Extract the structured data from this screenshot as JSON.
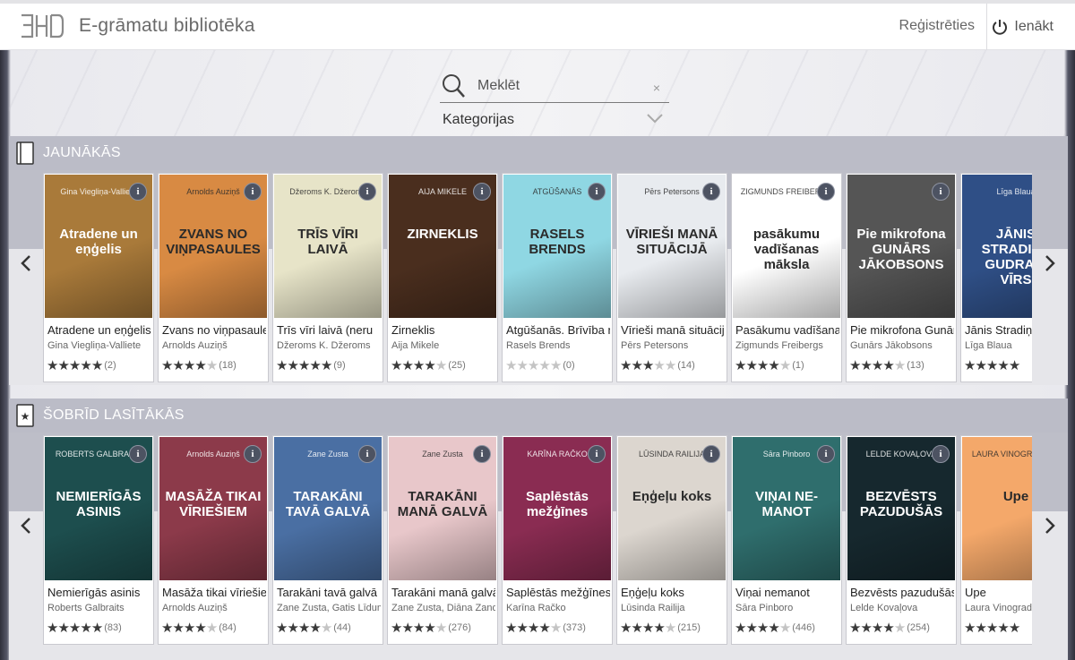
{
  "header": {
    "site_title": "E-grāmatu  bibliotēka",
    "register_label": "Reģistrēties",
    "login_label": "Ienākt"
  },
  "search": {
    "placeholder": "Meklēt",
    "clear_symbol": "×",
    "categories_label": "Kategorijas"
  },
  "sections": [
    {
      "title": "JAUNĀKĀS",
      "icon": "book-icon",
      "books": [
        {
          "title": "Atradene un eņģelis",
          "author": "Gina Viegliņa-Valliete",
          "stars": 5,
          "count": "(2)",
          "cover_text": "Atradene un eņģelis",
          "cover_sub": "Gina Viegliņa-Valliete",
          "color": "#a97a3a"
        },
        {
          "title": "Zvans no viņpasaules",
          "author": "Arnolds Auziņš",
          "stars": 4,
          "count": "(18)",
          "cover_text": "ZVANS NO VIŅPASAULES",
          "cover_sub": "Arnolds Auziņš",
          "color": "#d88a43"
        },
        {
          "title": "Trīs vīri laivā (neru",
          "author": "Džeroms K. Džeroms",
          "stars": 5,
          "count": "(9)",
          "cover_text": "TRĪS VĪRI LAIVĀ",
          "cover_sub": "Džeroms K. Džeroms",
          "color": "#e7e4c8"
        },
        {
          "title": "Zirneklis",
          "author": "Aija Mikele",
          "stars": 4.5,
          "count": "(25)",
          "cover_text": "ZIRNEKLIS",
          "cover_sub": "AIJA MIKELE",
          "color": "#4a2e1e"
        },
        {
          "title": "Atgūšanās. Brīvība no",
          "author": "Rasels Brends",
          "stars": 0,
          "count": "(0)",
          "cover_text": "RASELS BRENDS",
          "cover_sub": "ATGŪŠANĀS",
          "color": "#8fd7e3"
        },
        {
          "title": "Vīrieši manā situācijā",
          "author": "Pērs Petersons",
          "stars": 3.5,
          "count": "(14)",
          "cover_text": "VĪRIEŠI MANĀ SITUĀCIJĀ",
          "cover_sub": "Pērs Petersons",
          "color": "#e8ebef"
        },
        {
          "title": "Pasākumu vadīšanas",
          "author": "Zigmunds Freibergs",
          "stars": 4,
          "count": "(1)",
          "cover_text": "pasākumu vadīšanas māksla",
          "cover_sub": "ZIGMUNDS FREIBERGS",
          "color": "#ffffff"
        },
        {
          "title": "Pie mikrofona Gunārs",
          "author": "Gunārs Jākobsons",
          "stars": 4.5,
          "count": "(13)",
          "cover_text": "Pie mikrofona GUNĀRS JĀKOBSONS",
          "cover_sub": "",
          "color": "#555555"
        },
        {
          "title": "Jānis Stradiņš",
          "author": "Līga Blaua",
          "stars": 5,
          "count": "",
          "cover_text": "JĀNIS STRADIŅŠ GUDRAIS VĪRS",
          "cover_sub": "Līga Blaua",
          "color": "#2f4f86"
        }
      ]
    },
    {
      "title": "ŠOBRĪD LASĪTĀKĀS",
      "icon": "star-book-icon",
      "books": [
        {
          "title": "Nemierīgās asinis",
          "author": "Roberts Galbraits",
          "stars": 5,
          "count": "(83)",
          "cover_text": "NEMIERĪGĀS ASINIS",
          "cover_sub": "ROBERTS GALBRAITS",
          "color": "#1d4e4e"
        },
        {
          "title": "Masāža tikai vīriešiem",
          "author": "Arnolds Auziņš",
          "stars": 4,
          "count": "(84)",
          "cover_text": "MASĀŽA TIKAI VĪRIEŠIEM",
          "cover_sub": "Arnolds Auziņš",
          "color": "#8c3a4a"
        },
        {
          "title": "Tarakāni tavā galvā",
          "author": "Zane Zusta, Gatis Līduma",
          "stars": 4,
          "count": "(44)",
          "cover_text": "TARAKĀNI TAVĀ GALVĀ",
          "cover_sub": "Zane Zusta",
          "color": "#4a6fa3"
        },
        {
          "title": "Tarakāni manā galvā",
          "author": "Zane Zusta, Diāna Zande",
          "stars": 4,
          "count": "(276)",
          "cover_text": "TARAKĀNI MANĀ GALVĀ",
          "cover_sub": "Zane Zusta",
          "color": "#e8c7ca"
        },
        {
          "title": "Saplēstās mežģīnes",
          "author": "Karīna Račko",
          "stars": 4,
          "count": "(373)",
          "cover_text": "Saplēstās mežģīnes",
          "cover_sub": "KARĪNA RAČKO",
          "color": "#8a2c52"
        },
        {
          "title": "Eņģeļu koks",
          "author": "Lūsinda Railija",
          "stars": 4.5,
          "count": "(215)",
          "cover_text": "Eņģeļu koks",
          "cover_sub": "LŪSINDA RAILIJA",
          "color": "#dcd6cf"
        },
        {
          "title": "Viņai nemanot",
          "author": "Sāra Pinboro",
          "stars": 4,
          "count": "(446)",
          "cover_text": "VIŅAI NE-MANOT",
          "cover_sub": "Sāra Pinboro",
          "color": "#2f6e6d"
        },
        {
          "title": "Bezvēsts pazudušās",
          "author": "Lelde Kovaļova",
          "stars": 4,
          "count": "(254)",
          "cover_text": "BEZVĒSTS PAZUDUŠĀS",
          "cover_sub": "LELDE KOVAĻOVA",
          "color": "#16282e"
        },
        {
          "title": "Upe",
          "author": "Laura Vinogradova",
          "stars": 5,
          "count": "",
          "cover_text": "Upe",
          "cover_sub": "LAURA VINOGRADOVA",
          "color": "#f4a86a"
        }
      ]
    }
  ],
  "colors": {
    "section_header_bg": "#bbbcc7",
    "topbar_bg": "#ffffff",
    "star_on": "#3a3a3a",
    "star_off": "#c4c4c4"
  }
}
